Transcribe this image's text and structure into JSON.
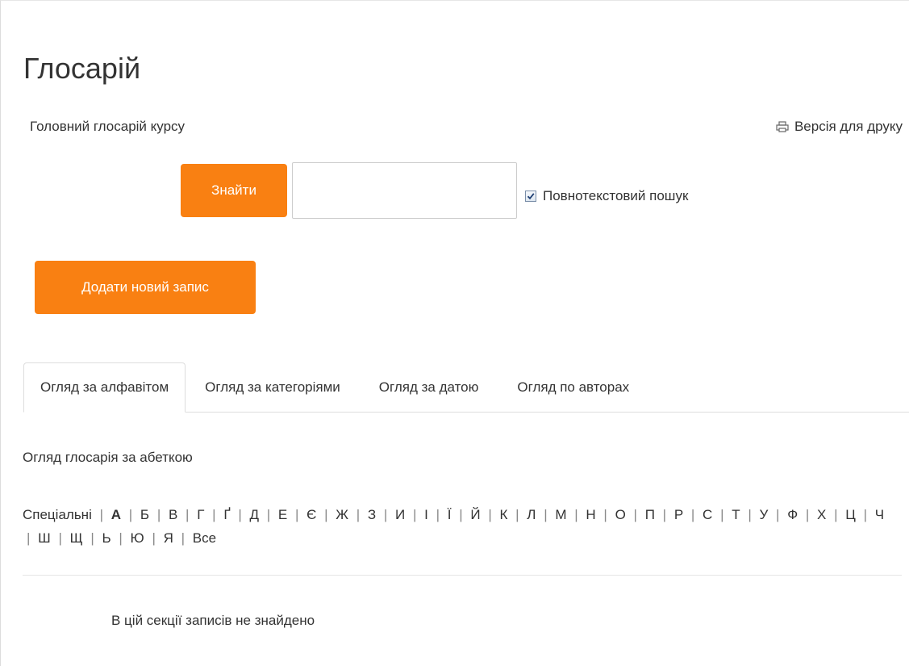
{
  "page": {
    "title": "Глосарій",
    "subtitle": "Головний глосарій курсу",
    "print_label": "Версія для друку",
    "print_icon": "printer-icon"
  },
  "search": {
    "button_label": "Знайти",
    "input_value": "",
    "input_placeholder": "",
    "fulltext_label": "Повнотекстовий пошук",
    "fulltext_checked": true
  },
  "add_entry": {
    "label": "Додати новий запис"
  },
  "tabs": [
    {
      "label": "Огляд за алфавітом",
      "active": true
    },
    {
      "label": "Огляд за категоріями",
      "active": false
    },
    {
      "label": "Огляд за датою",
      "active": false
    },
    {
      "label": "Огляд по авторах",
      "active": false
    }
  ],
  "browse": {
    "section_label": "Огляд глосарія за абеткою",
    "letters": [
      "Спеціальні",
      "А",
      "Б",
      "В",
      "Г",
      "Ґ",
      "Д",
      "Е",
      "Є",
      "Ж",
      "З",
      "И",
      "І",
      "Ї",
      "Й",
      "К",
      "Л",
      "М",
      "Н",
      "О",
      "П",
      "Р",
      "С",
      "Т",
      "У",
      "Ф",
      "Х",
      "Ц",
      "Ч",
      "Ш",
      "Щ",
      "Ь",
      "Ю",
      "Я",
      "Все"
    ],
    "current_letter": "А",
    "empty_message": "В цій секції записів не знайдено"
  },
  "colors": {
    "accent": "#f98012",
    "text": "#333333",
    "border": "#dddddd"
  }
}
